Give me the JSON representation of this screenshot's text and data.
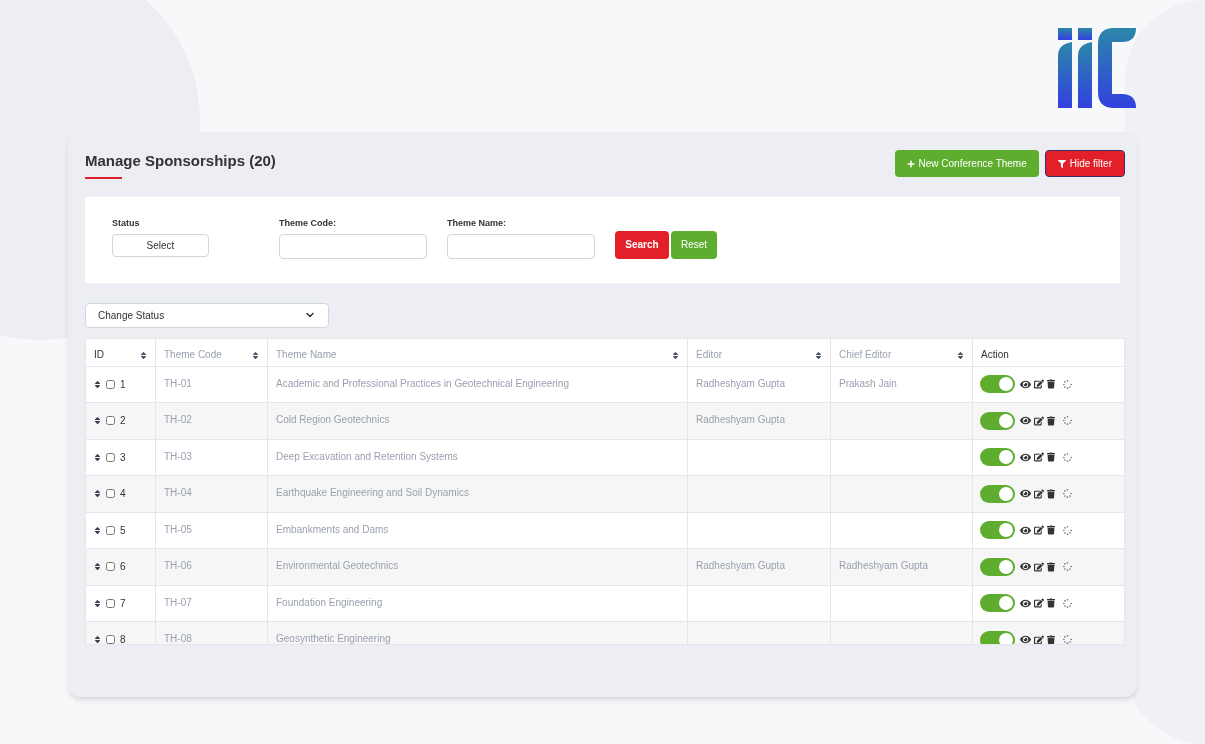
{
  "page": {
    "title": "Manage Sponsorships (20)"
  },
  "header_buttons": [
    {
      "kind": "new",
      "label": "New Conference Theme"
    },
    {
      "kind": "filter",
      "label": "Hide filter"
    }
  ],
  "filters": {
    "status": {
      "label": "Status",
      "value": "Select"
    },
    "theme_code": {
      "label": "Theme Code:"
    },
    "theme_name": {
      "label": "Theme Name:"
    },
    "buttons": [
      {
        "kind": "search",
        "label": "Search"
      },
      {
        "kind": "reset",
        "label": "Reset"
      }
    ]
  },
  "bulk_action": {
    "value": "Change Status"
  },
  "table": {
    "columns": [
      "ID",
      "Theme Code",
      "Theme Name",
      "Editor",
      "Chief Editor",
      "Action"
    ],
    "rows": [
      {
        "id": "1",
        "checked": false,
        "code": "TH-01",
        "name": "Academic and Professional Practices in Geotechnical Engineering",
        "editor": "Radheshyam Gupta",
        "chief_editor": "Prakash Jain",
        "on": true
      },
      {
        "id": "2",
        "checked": false,
        "code": "TH-02",
        "name": "Cold Region Geotechnics",
        "editor": "Radheshyam Gupta",
        "on": true
      },
      {
        "id": "3",
        "checked": false,
        "code": "TH-03",
        "name": "Deep Excavation and Retention Systems",
        "on": true
      },
      {
        "id": "4",
        "checked": false,
        "code": "TH-04",
        "name": "Earthquake Engineering and Soil Dynamics",
        "on": true
      },
      {
        "id": "5",
        "checked": false,
        "code": "TH-05",
        "name": "Embankments and Dams",
        "on": true
      },
      {
        "id": "6",
        "checked": false,
        "code": "TH-06",
        "name": "Environmental Geotechnics",
        "editor": "Radheshyam Gupta",
        "chief_editor": "Radheshyam Gupta",
        "on": true
      },
      {
        "id": "7",
        "checked": false,
        "code": "TH-07",
        "name": "Foundation Engineering",
        "on": true
      },
      {
        "id": "8",
        "checked": false,
        "code": "TH-08",
        "name": "Geosynthetic Engineering",
        "on": true
      }
    ]
  }
}
